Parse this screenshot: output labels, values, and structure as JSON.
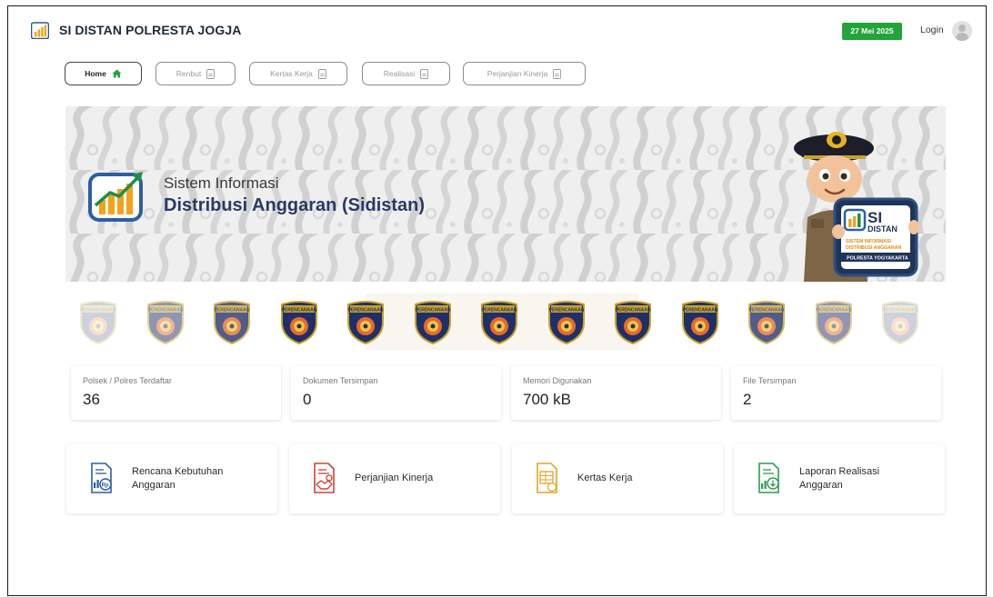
{
  "header": {
    "app_title": "SI DISTAN POLRESTA JOGJA",
    "date_badge": "27 Mei 2025",
    "login_label": "Login"
  },
  "nav": {
    "items": [
      {
        "label": "Home",
        "icon": "home-icon",
        "active": true
      },
      {
        "label": "Renbut",
        "icon": "document-icon",
        "active": false
      },
      {
        "label": "Kertas Kerja",
        "icon": "document-icon",
        "active": false
      },
      {
        "label": "Realisasi",
        "icon": "document-icon",
        "active": false
      },
      {
        "label": "Perjanjian Kinerja",
        "icon": "document-icon",
        "active": false
      }
    ]
  },
  "hero": {
    "subtitle": "Sistem Informasi",
    "title": "Distribusi Anggaran (Sidistan)",
    "mascot_sign": {
      "line1": "SI",
      "line2": "DISTAN",
      "line3": "SISTEM INFORMASI",
      "line4": "DISTRIBUSI ANGGARAN",
      "line5": "POLRESTA YOGYAKARTA"
    }
  },
  "badge_strip": {
    "badge_text": "PERENCANAAN",
    "count": 13
  },
  "stats": [
    {
      "label": "Polsek / Polres Terdaftar",
      "value": "36"
    },
    {
      "label": "Dokumen Tersimpan",
      "value": "0"
    },
    {
      "label": "Memori Digunakan",
      "value": "700 kB"
    },
    {
      "label": "File Tersimpan",
      "value": "2"
    }
  ],
  "features": [
    {
      "line1": "Rencana Kebutuhan",
      "line2": "Anggaran",
      "icon": "budget-plan-icon"
    },
    {
      "line1": "Perjanjian Kinerja",
      "line2": "",
      "icon": "agreement-icon"
    },
    {
      "line1": "Kertas Kerja",
      "line2": "",
      "icon": "worksheet-icon"
    },
    {
      "line1": "Laporan Realisasi",
      "line2": "Anggaran",
      "icon": "realization-report-icon"
    }
  ],
  "colors": {
    "brand_navy": "#2a3a66",
    "date_badge_green": "#23a339",
    "accent_orange": "#f2a31b"
  }
}
